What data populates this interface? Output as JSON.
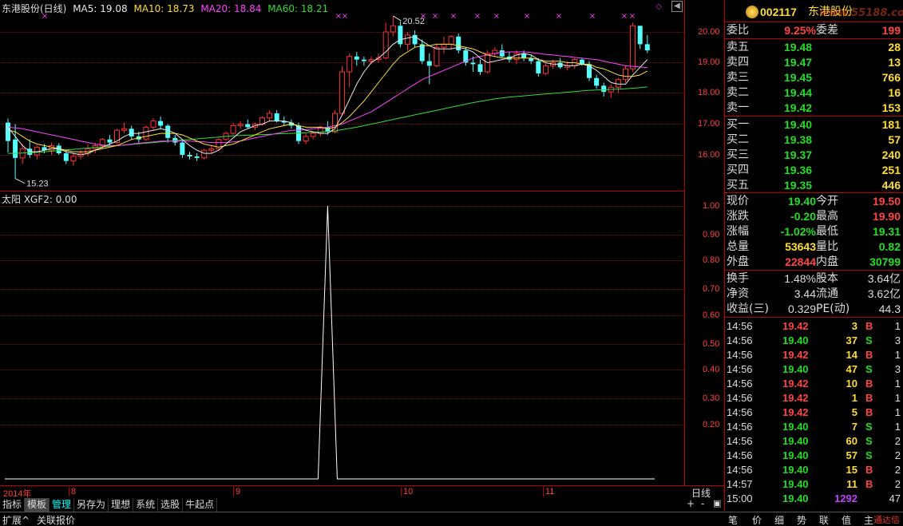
{
  "main_chart": {
    "stock_label": "东港股份(日线)",
    "ma5_label": "MA5: 19.08",
    "ma10_label": "MA10: 18.73",
    "ma20_label": "MA20: 18.84",
    "ma60_label": "MA60: 18.21",
    "high_annotation": "20.52",
    "low_annotation": "15.23",
    "y_ticks": [
      "20.00",
      "19.00",
      "18.00",
      "17.00",
      "16.00"
    ]
  },
  "indicator_chart": {
    "label": "太阳  XGF2: 0.00",
    "y_ticks": [
      "1.00",
      "0.90",
      "0.80",
      "0.70",
      "0.60",
      "0.50",
      "0.40",
      "0.30",
      "0.20"
    ]
  },
  "x_axis": {
    "labels": [
      "2014年",
      "8",
      "9",
      "10",
      "11"
    ],
    "period_label": "日线"
  },
  "toolbar": {
    "items": [
      "指标",
      "模板",
      "管理",
      "另存为",
      "理想",
      "系统",
      "选股",
      "牛起点"
    ],
    "zoom_in": "+",
    "zoom_out": "-",
    "collapse": "▣"
  },
  "status_bar": {
    "left": [
      "扩展^",
      "关联报价"
    ],
    "right": [
      "笔",
      "价",
      "细",
      "势",
      "联",
      "值",
      "主"
    ],
    "watermark": "通达信"
  },
  "quote": {
    "code": "002117",
    "name": "东港股份",
    "logo_text": "www.55188.com",
    "webi_label": "委比",
    "webi_value": "9.25%",
    "weicha_label": "委差",
    "weicha_value": "199",
    "asks": [
      {
        "label": "卖五",
        "price": "19.48",
        "vol": "28"
      },
      {
        "label": "卖四",
        "price": "19.47",
        "vol": "13"
      },
      {
        "label": "卖三",
        "price": "19.45",
        "vol": "766"
      },
      {
        "label": "卖二",
        "price": "19.44",
        "vol": "16"
      },
      {
        "label": "卖一",
        "price": "19.42",
        "vol": "153"
      }
    ],
    "bids": [
      {
        "label": "买一",
        "price": "19.40",
        "vol": "181"
      },
      {
        "label": "买二",
        "price": "19.38",
        "vol": "57"
      },
      {
        "label": "买三",
        "price": "19.37",
        "vol": "240"
      },
      {
        "label": "买四",
        "price": "19.36",
        "vol": "251"
      },
      {
        "label": "买五",
        "price": "19.35",
        "vol": "446"
      }
    ],
    "stats": [
      {
        "l1": "现价",
        "v1": "19.40",
        "c1": "#22dd22",
        "l2": "今开",
        "v2": "19.50",
        "c2": "#ff4444"
      },
      {
        "l1": "涨跌",
        "v1": "-0.20",
        "c1": "#22dd22",
        "l2": "最高",
        "v2": "19.90",
        "c2": "#ff4444"
      },
      {
        "l1": "涨幅",
        "v1": "-1.02%",
        "c1": "#22dd22",
        "l2": "最低",
        "v2": "19.31",
        "c2": "#22dd22"
      },
      {
        "l1": "总量",
        "v1": "53643",
        "c1": "#ffdd33",
        "l2": "量比",
        "v2": "0.82",
        "c2": "#22dd22"
      },
      {
        "l1": "外盘",
        "v1": "22844",
        "c1": "#ff4444",
        "l2": "内盘",
        "v2": "30799",
        "c2": "#22dd22"
      }
    ],
    "fund": [
      {
        "l1": "换手",
        "v1": "1.48%",
        "l2": "股本",
        "v2": "3.64亿"
      },
      {
        "l1": "净资",
        "v1": "3.44",
        "l2": "流通",
        "v2": "3.62亿"
      },
      {
        "l1": "收益(三)",
        "v1": "0.329",
        "l2": "PE(动)",
        "v2": "44.3"
      }
    ]
  },
  "ticks": [
    {
      "time": "14:56",
      "price": "19.42",
      "vol": "3",
      "bs": "B",
      "n": "1"
    },
    {
      "time": "14:56",
      "price": "19.40",
      "vol": "37",
      "bs": "S",
      "n": "3"
    },
    {
      "time": "14:56",
      "price": "19.42",
      "vol": "14",
      "bs": "B",
      "n": "1"
    },
    {
      "time": "14:56",
      "price": "19.40",
      "vol": "47",
      "bs": "S",
      "n": "3"
    },
    {
      "time": "14:56",
      "price": "19.42",
      "vol": "10",
      "bs": "B",
      "n": "1"
    },
    {
      "time": "14:56",
      "price": "19.42",
      "vol": "1",
      "bs": "B",
      "n": "1"
    },
    {
      "time": "14:56",
      "price": "19.42",
      "vol": "5",
      "bs": "B",
      "n": "1"
    },
    {
      "time": "14:56",
      "price": "19.40",
      "vol": "7",
      "bs": "S",
      "n": "1"
    },
    {
      "time": "14:56",
      "price": "19.40",
      "vol": "60",
      "bs": "S",
      "n": "2"
    },
    {
      "time": "14:56",
      "price": "19.40",
      "vol": "57",
      "bs": "S",
      "n": "2"
    },
    {
      "time": "14:56",
      "price": "19.40",
      "vol": "15",
      "bs": "B",
      "n": "2"
    },
    {
      "time": "14:57",
      "price": "19.40",
      "vol": "11",
      "bs": "B",
      "n": "2"
    },
    {
      "time": "15:00",
      "price": "19.40",
      "vol": "1292",
      "bs": "",
      "n": "47"
    }
  ],
  "candles": [
    {
      "o": 17.05,
      "h": 17.18,
      "l": 16.08,
      "c": 16.45
    },
    {
      "o": 16.5,
      "h": 17.0,
      "l": 15.23,
      "c": 15.9
    },
    {
      "o": 15.9,
      "h": 16.35,
      "l": 15.7,
      "c": 16.2
    },
    {
      "o": 16.2,
      "h": 16.5,
      "l": 15.9,
      "c": 16.0
    },
    {
      "o": 16.0,
      "h": 16.3,
      "l": 15.85,
      "c": 16.25
    },
    {
      "o": 16.25,
      "h": 16.35,
      "l": 16.05,
      "c": 16.15
    },
    {
      "o": 16.15,
      "h": 16.4,
      "l": 16.0,
      "c": 16.3
    },
    {
      "o": 16.3,
      "h": 16.38,
      "l": 16.0,
      "c": 16.05
    },
    {
      "o": 16.05,
      "h": 16.15,
      "l": 15.7,
      "c": 15.8
    },
    {
      "o": 15.8,
      "h": 16.05,
      "l": 15.65,
      "c": 15.95
    },
    {
      "o": 15.95,
      "h": 16.15,
      "l": 15.85,
      "c": 16.05
    },
    {
      "o": 16.05,
      "h": 16.35,
      "l": 15.95,
      "c": 16.2
    },
    {
      "o": 16.2,
      "h": 16.4,
      "l": 16.05,
      "c": 16.3
    },
    {
      "o": 16.3,
      "h": 16.55,
      "l": 16.2,
      "c": 16.5
    },
    {
      "o": 16.5,
      "h": 16.65,
      "l": 16.3,
      "c": 16.4
    },
    {
      "o": 16.4,
      "h": 16.85,
      "l": 16.35,
      "c": 16.8
    },
    {
      "o": 16.8,
      "h": 17.05,
      "l": 16.7,
      "c": 16.85
    },
    {
      "o": 16.85,
      "h": 16.95,
      "l": 16.5,
      "c": 16.6
    },
    {
      "o": 16.6,
      "h": 16.75,
      "l": 16.4,
      "c": 16.5
    },
    {
      "o": 16.5,
      "h": 16.95,
      "l": 16.45,
      "c": 16.9
    },
    {
      "o": 16.9,
      "h": 17.2,
      "l": 16.8,
      "c": 17.1
    },
    {
      "o": 17.1,
      "h": 17.25,
      "l": 16.85,
      "c": 16.95
    },
    {
      "o": 16.95,
      "h": 17.0,
      "l": 16.4,
      "c": 16.55
    },
    {
      "o": 16.55,
      "h": 16.65,
      "l": 16.3,
      "c": 16.4
    },
    {
      "o": 16.4,
      "h": 16.5,
      "l": 15.9,
      "c": 16.0
    },
    {
      "o": 16.0,
      "h": 16.1,
      "l": 15.85,
      "c": 15.95
    },
    {
      "o": 15.95,
      "h": 16.05,
      "l": 15.8,
      "c": 15.9
    },
    {
      "o": 15.9,
      "h": 16.2,
      "l": 15.85,
      "c": 16.15
    },
    {
      "o": 16.15,
      "h": 16.3,
      "l": 16.05,
      "c": 16.2
    },
    {
      "o": 16.2,
      "h": 16.55,
      "l": 16.15,
      "c": 16.5
    },
    {
      "o": 16.5,
      "h": 16.75,
      "l": 16.45,
      "c": 16.7
    },
    {
      "o": 16.7,
      "h": 17.05,
      "l": 16.65,
      "c": 16.95
    },
    {
      "o": 16.95,
      "h": 17.1,
      "l": 16.85,
      "c": 17.0
    },
    {
      "o": 17.0,
      "h": 17.15,
      "l": 16.85,
      "c": 16.9
    },
    {
      "o": 16.9,
      "h": 17.05,
      "l": 16.8,
      "c": 17.0
    },
    {
      "o": 17.0,
      "h": 17.25,
      "l": 16.95,
      "c": 17.2
    },
    {
      "o": 17.2,
      "h": 17.45,
      "l": 17.1,
      "c": 17.35
    },
    {
      "o": 17.35,
      "h": 17.45,
      "l": 17.05,
      "c": 17.1
    },
    {
      "o": 17.1,
      "h": 17.25,
      "l": 16.95,
      "c": 17.05
    },
    {
      "o": 17.05,
      "h": 17.15,
      "l": 16.85,
      "c": 16.95
    },
    {
      "o": 16.95,
      "h": 17.05,
      "l": 16.35,
      "c": 16.45
    },
    {
      "o": 16.45,
      "h": 16.7,
      "l": 16.35,
      "c": 16.6
    },
    {
      "o": 16.6,
      "h": 16.75,
      "l": 16.5,
      "c": 16.7
    },
    {
      "o": 16.7,
      "h": 16.95,
      "l": 16.6,
      "c": 16.9
    },
    {
      "o": 16.9,
      "h": 17.1,
      "l": 16.65,
      "c": 16.75
    },
    {
      "o": 16.75,
      "h": 17.45,
      "l": 16.7,
      "c": 17.35
    },
    {
      "o": 17.35,
      "h": 18.9,
      "l": 17.3,
      "c": 18.7
    },
    {
      "o": 18.7,
      "h": 19.3,
      "l": 18.2,
      "c": 19.2
    },
    {
      "o": 19.2,
      "h": 19.35,
      "l": 18.9,
      "c": 19.1
    },
    {
      "o": 19.1,
      "h": 19.2,
      "l": 18.9,
      "c": 19.05
    },
    {
      "o": 19.05,
      "h": 19.2,
      "l": 18.95,
      "c": 19.1
    },
    {
      "o": 19.1,
      "h": 19.3,
      "l": 19.0,
      "c": 19.15
    },
    {
      "o": 19.15,
      "h": 20.3,
      "l": 19.1,
      "c": 20.0
    },
    {
      "o": 20.0,
      "h": 20.52,
      "l": 19.85,
      "c": 20.2
    },
    {
      "o": 20.2,
      "h": 20.35,
      "l": 19.5,
      "c": 19.6
    },
    {
      "o": 19.6,
      "h": 20.0,
      "l": 19.4,
      "c": 19.9
    },
    {
      "o": 19.9,
      "h": 20.05,
      "l": 19.5,
      "c": 19.6
    },
    {
      "o": 19.6,
      "h": 19.75,
      "l": 18.95,
      "c": 19.05
    },
    {
      "o": 19.05,
      "h": 19.3,
      "l": 18.3,
      "c": 18.9
    },
    {
      "o": 18.9,
      "h": 19.6,
      "l": 18.85,
      "c": 19.5
    },
    {
      "o": 19.5,
      "h": 19.85,
      "l": 19.3,
      "c": 19.6
    },
    {
      "o": 19.6,
      "h": 19.9,
      "l": 19.45,
      "c": 19.85
    },
    {
      "o": 19.85,
      "h": 19.95,
      "l": 19.3,
      "c": 19.4
    },
    {
      "o": 19.4,
      "h": 19.5,
      "l": 18.9,
      "c": 19.0
    },
    {
      "o": 19.0,
      "h": 19.2,
      "l": 18.7,
      "c": 18.95
    },
    {
      "o": 18.95,
      "h": 19.1,
      "l": 18.6,
      "c": 18.7
    },
    {
      "o": 18.7,
      "h": 19.4,
      "l": 18.65,
      "c": 19.3
    },
    {
      "o": 19.3,
      "h": 19.5,
      "l": 19.2,
      "c": 19.4
    },
    {
      "o": 19.4,
      "h": 19.6,
      "l": 19.15,
      "c": 19.2
    },
    {
      "o": 19.2,
      "h": 19.35,
      "l": 19.0,
      "c": 19.1
    },
    {
      "o": 19.1,
      "h": 19.4,
      "l": 18.95,
      "c": 19.3
    },
    {
      "o": 19.3,
      "h": 19.4,
      "l": 19.05,
      "c": 19.15
    },
    {
      "o": 19.15,
      "h": 19.25,
      "l": 18.95,
      "c": 19.05
    },
    {
      "o": 19.05,
      "h": 19.15,
      "l": 18.55,
      "c": 18.65
    },
    {
      "o": 18.65,
      "h": 19.0,
      "l": 18.6,
      "c": 18.9
    },
    {
      "o": 18.9,
      "h": 19.1,
      "l": 18.8,
      "c": 19.0
    },
    {
      "o": 19.0,
      "h": 19.15,
      "l": 18.8,
      "c": 18.85
    },
    {
      "o": 18.85,
      "h": 19.05,
      "l": 18.75,
      "c": 18.9
    },
    {
      "o": 18.9,
      "h": 19.15,
      "l": 18.8,
      "c": 19.1
    },
    {
      "o": 19.1,
      "h": 19.15,
      "l": 18.9,
      "c": 18.95
    },
    {
      "o": 18.95,
      "h": 19.05,
      "l": 18.4,
      "c": 18.5
    },
    {
      "o": 18.5,
      "h": 18.6,
      "l": 18.15,
      "c": 18.25
    },
    {
      "o": 18.25,
      "h": 18.35,
      "l": 17.9,
      "c": 18.05
    },
    {
      "o": 18.05,
      "h": 18.3,
      "l": 17.85,
      "c": 18.2
    },
    {
      "o": 18.2,
      "h": 18.5,
      "l": 18.0,
      "c": 18.45
    },
    {
      "o": 18.45,
      "h": 18.9,
      "l": 18.35,
      "c": 18.8
    },
    {
      "o": 18.8,
      "h": 20.3,
      "l": 18.7,
      "c": 20.2
    },
    {
      "o": 20.2,
      "h": 20.2,
      "l": 19.45,
      "c": 19.6
    },
    {
      "o": 19.6,
      "h": 19.9,
      "l": 19.31,
      "c": 19.4
    }
  ],
  "ma_lines": {
    "ma5": [
      16.9,
      16.6,
      16.3,
      16.1,
      16.1,
      16.15,
      16.2,
      16.2,
      16.1,
      16.05,
      16.0,
      16.05,
      16.15,
      16.25,
      16.35,
      16.45,
      16.6,
      16.7,
      16.7,
      16.75,
      16.8,
      16.85,
      16.8,
      16.7,
      16.5,
      16.3,
      16.15,
      16.05,
      16.05,
      16.15,
      16.35,
      16.55,
      16.75,
      16.85,
      16.95,
      17.0,
      17.1,
      17.1,
      17.1,
      17.05,
      16.9,
      16.8,
      16.75,
      16.7,
      16.7,
      16.85,
      17.3,
      17.8,
      18.3,
      18.7,
      19.0,
      19.15,
      19.35,
      19.6,
      19.75,
      19.8,
      19.85,
      19.7,
      19.55,
      19.45,
      19.45,
      19.45,
      19.5,
      19.45,
      19.35,
      19.15,
      19.0,
      19.05,
      19.1,
      19.15,
      19.25,
      19.3,
      19.25,
      19.1,
      19.0,
      18.95,
      18.95,
      18.9,
      18.9,
      18.95,
      18.9,
      18.75,
      18.55,
      18.35,
      18.3,
      18.3,
      18.6,
      18.85,
      19.1
    ],
    "ma10": [
      16.8,
      16.75,
      16.6,
      16.45,
      16.35,
      16.3,
      16.25,
      16.2,
      16.15,
      16.1,
      16.1,
      16.1,
      16.15,
      16.2,
      16.25,
      16.3,
      16.4,
      16.5,
      16.55,
      16.6,
      16.65,
      16.7,
      16.7,
      16.7,
      16.65,
      16.55,
      16.45,
      16.35,
      16.3,
      16.25,
      16.3,
      16.35,
      16.45,
      16.55,
      16.65,
      16.75,
      16.85,
      16.9,
      16.95,
      17.0,
      16.95,
      16.9,
      16.9,
      16.9,
      16.85,
      16.9,
      17.05,
      17.25,
      17.5,
      17.75,
      18.05,
      18.35,
      18.65,
      18.95,
      19.2,
      19.35,
      19.5,
      19.55,
      19.55,
      19.6,
      19.6,
      19.6,
      19.55,
      19.5,
      19.45,
      19.35,
      19.25,
      19.2,
      19.15,
      19.15,
      19.15,
      19.15,
      19.15,
      19.1,
      19.05,
      19.05,
      19.05,
      19.0,
      19.0,
      18.95,
      18.95,
      18.85,
      18.8,
      18.7,
      18.6,
      18.55,
      18.55,
      18.6,
      18.73
    ],
    "ma20": [
      16.9,
      16.88,
      16.85,
      16.8,
      16.75,
      16.7,
      16.65,
      16.6,
      16.55,
      16.5,
      16.45,
      16.4,
      16.35,
      16.32,
      16.3,
      16.3,
      16.32,
      16.35,
      16.38,
      16.4,
      16.42,
      16.45,
      16.45,
      16.45,
      16.45,
      16.45,
      16.43,
      16.42,
      16.4,
      16.4,
      16.4,
      16.42,
      16.45,
      16.5,
      16.55,
      16.6,
      16.65,
      16.7,
      16.75,
      16.8,
      16.8,
      16.82,
      16.85,
      16.87,
      16.9,
      16.95,
      17.0,
      17.1,
      17.2,
      17.3,
      17.4,
      17.55,
      17.7,
      17.85,
      18.0,
      18.15,
      18.3,
      18.45,
      18.55,
      18.65,
      18.75,
      18.85,
      18.95,
      19.05,
      19.15,
      19.2,
      19.25,
      19.3,
      19.33,
      19.35,
      19.35,
      19.35,
      19.33,
      19.3,
      19.27,
      19.25,
      19.22,
      19.2,
      19.17,
      19.15,
      19.12,
      19.1,
      19.05,
      19.0,
      18.95,
      18.9,
      18.88,
      18.86,
      18.84
    ],
    "ma60": [
      16.05,
      16.05,
      16.06,
      16.07,
      16.08,
      16.1,
      16.12,
      16.14,
      16.16,
      16.18,
      16.2,
      16.22,
      16.24,
      16.26,
      16.28,
      16.3,
      16.32,
      16.34,
      16.36,
      16.38,
      16.4,
      16.42,
      16.44,
      16.46,
      16.48,
      16.5,
      16.52,
      16.54,
      16.56,
      16.58,
      16.6,
      16.62,
      16.63,
      16.64,
      16.65,
      16.66,
      16.67,
      16.68,
      16.69,
      16.7,
      16.71,
      16.72,
      16.73,
      16.74,
      16.76,
      16.78,
      16.82,
      16.86,
      16.9,
      16.95,
      17.0,
      17.05,
      17.1,
      17.15,
      17.2,
      17.25,
      17.3,
      17.35,
      17.4,
      17.45,
      17.5,
      17.55,
      17.6,
      17.65,
      17.7,
      17.74,
      17.78,
      17.82,
      17.85,
      17.88,
      17.9,
      17.92,
      17.94,
      17.96,
      17.98,
      18.0,
      18.02,
      18.04,
      18.06,
      18.08,
      18.1,
      18.11,
      18.12,
      18.13,
      18.14,
      18.15,
      18.17,
      18.19,
      18.21
    ]
  },
  "xgf2_spike_index": 44,
  "colors": {
    "up": "#ff3333",
    "down": "#54ffff",
    "ma5": "#e8e8e8",
    "ma10": "#ffdd33",
    "ma20": "#ff44ff",
    "ma60": "#33dd33",
    "border": "#b00000"
  }
}
